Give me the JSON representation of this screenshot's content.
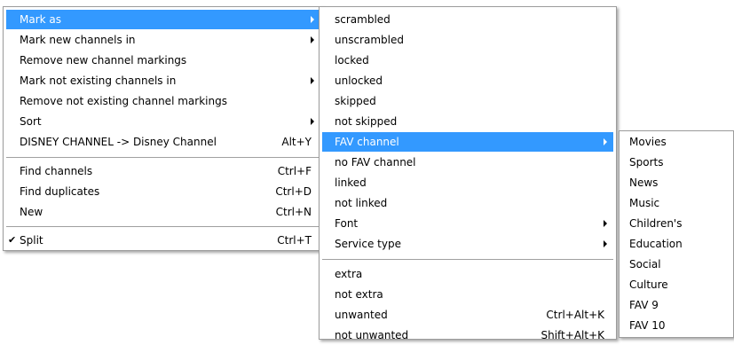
{
  "main_menu": {
    "items": [
      {
        "label": "Mark as"
      },
      {
        "label": "Mark new channels in"
      },
      {
        "label": "Remove new channel markings"
      },
      {
        "label": "Mark not existing channels in"
      },
      {
        "label": "Remove not existing channel markings"
      },
      {
        "label": "Sort"
      },
      {
        "label": "DISNEY CHANNEL -> Disney Channel",
        "shortcut": "Alt+Y"
      },
      {
        "label": "Find channels",
        "shortcut": "Ctrl+F"
      },
      {
        "label": "Find duplicates",
        "shortcut": "Ctrl+D"
      },
      {
        "label": "New",
        "shortcut": "Ctrl+N"
      },
      {
        "label": "Split",
        "shortcut": "Ctrl+T",
        "check": "✔"
      }
    ]
  },
  "mark_as_submenu": {
    "items": [
      {
        "label": "scrambled"
      },
      {
        "label": "unscrambled"
      },
      {
        "label": "locked"
      },
      {
        "label": "unlocked"
      },
      {
        "label": "skipped"
      },
      {
        "label": "not skipped"
      },
      {
        "label": "FAV channel"
      },
      {
        "label": "no FAV channel"
      },
      {
        "label": "linked"
      },
      {
        "label": "not linked"
      },
      {
        "label": "Font"
      },
      {
        "label": "Service type"
      },
      {
        "label": "extra"
      },
      {
        "label": "not extra"
      },
      {
        "label": "unwanted",
        "shortcut": "Ctrl+Alt+K"
      },
      {
        "label": "not unwanted",
        "shortcut": "Shift+Alt+K"
      }
    ]
  },
  "fav_submenu": {
    "items": [
      {
        "label": "Movies"
      },
      {
        "label": "Sports"
      },
      {
        "label": "News"
      },
      {
        "label": "Music"
      },
      {
        "label": "Children's"
      },
      {
        "label": "Education"
      },
      {
        "label": "Social"
      },
      {
        "label": "Culture"
      },
      {
        "label": "FAV 9"
      },
      {
        "label": "FAV 10"
      }
    ]
  },
  "colors": {
    "highlight": "#3399ff",
    "highlight_text": "#ffffff",
    "menu_bg": "#ffffff",
    "border": "#9c9c9c"
  }
}
